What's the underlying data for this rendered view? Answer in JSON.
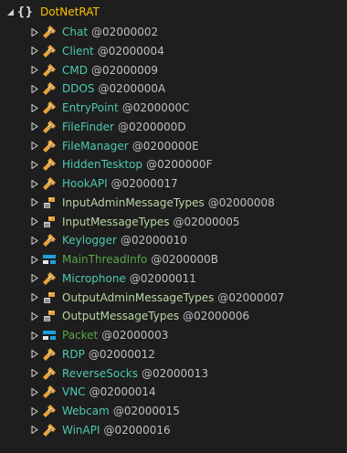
{
  "colors": {
    "class": "#4ec9b0",
    "enum": "#b8d7a3",
    "struct": "#5ba64b",
    "namespace": "#ffc000",
    "token": "#bfbfbf"
  },
  "tree": {
    "namespace": "DotNetRAT",
    "namespace_icon": "{}",
    "items": [
      {
        "name": "Chat",
        "token": "@02000002",
        "kind": "class",
        "icon": "class-icon"
      },
      {
        "name": "Client",
        "token": "@02000004",
        "kind": "class",
        "icon": "class-icon"
      },
      {
        "name": "CMD",
        "token": "@02000009",
        "kind": "class",
        "icon": "class-icon"
      },
      {
        "name": "DDOS",
        "token": "@0200000A",
        "kind": "class",
        "icon": "class-icon"
      },
      {
        "name": "EntryPoint",
        "token": "@0200000C",
        "kind": "class",
        "icon": "class-icon"
      },
      {
        "name": "FileFinder",
        "token": "@0200000D",
        "kind": "class",
        "icon": "class-icon"
      },
      {
        "name": "FileManager",
        "token": "@0200000E",
        "kind": "class",
        "icon": "class-icon"
      },
      {
        "name": "HiddenTesktop",
        "token": "@0200000F",
        "kind": "class",
        "icon": "class-icon"
      },
      {
        "name": "HookAPI",
        "token": "@02000017",
        "kind": "class",
        "icon": "class-icon"
      },
      {
        "name": "InputAdminMessageTypes",
        "token": "@02000008",
        "kind": "enum",
        "icon": "enum-icon"
      },
      {
        "name": "InputMessageTypes",
        "token": "@02000005",
        "kind": "enum",
        "icon": "enum-icon"
      },
      {
        "name": "Keylogger",
        "token": "@02000010",
        "kind": "class",
        "icon": "class-icon"
      },
      {
        "name": "MainThreadInfo",
        "token": "@0200000B",
        "kind": "struct",
        "icon": "struct-icon"
      },
      {
        "name": "Microphone",
        "token": "@02000011",
        "kind": "class",
        "icon": "class-icon"
      },
      {
        "name": "OutputAdminMessageTypes",
        "token": "@02000007",
        "kind": "enum",
        "icon": "enum-icon"
      },
      {
        "name": "OutputMessageTypes",
        "token": "@02000006",
        "kind": "enum",
        "icon": "enum-icon"
      },
      {
        "name": "Packet",
        "token": "@02000003",
        "kind": "struct",
        "icon": "struct-icon"
      },
      {
        "name": "RDP",
        "token": "@02000012",
        "kind": "class",
        "icon": "class-icon"
      },
      {
        "name": "ReverseSocks",
        "token": "@02000013",
        "kind": "class",
        "icon": "class-icon"
      },
      {
        "name": "VNC",
        "token": "@02000014",
        "kind": "class",
        "icon": "class-icon"
      },
      {
        "name": "Webcam",
        "token": "@02000015",
        "kind": "class",
        "icon": "class-icon"
      },
      {
        "name": "WinAPI",
        "token": "@02000016",
        "kind": "class",
        "icon": "class-icon"
      }
    ]
  }
}
